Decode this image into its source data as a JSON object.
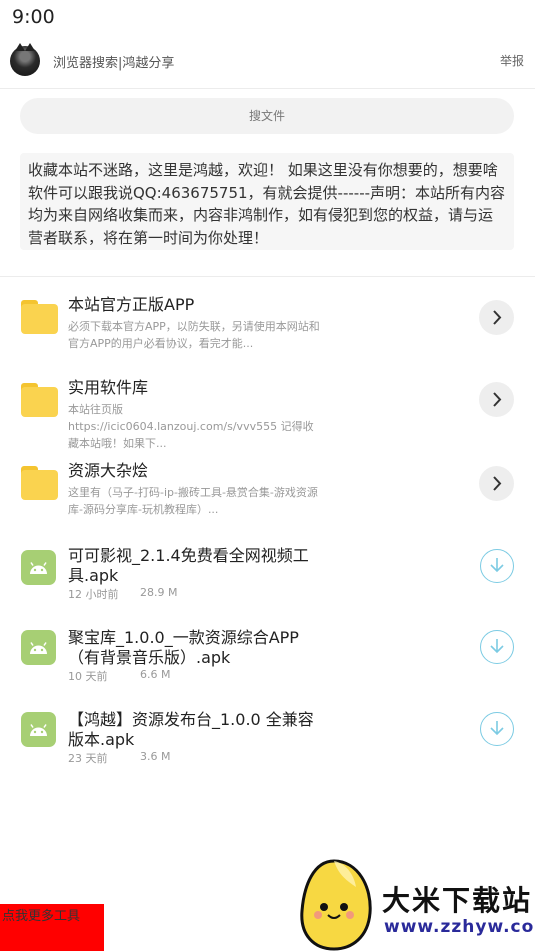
{
  "status_bar": {
    "time": "9:00"
  },
  "header": {
    "title": "浏览器搜索|鸿越分享",
    "report": "举报"
  },
  "search": {
    "placeholder": "搜文件"
  },
  "notice": {
    "text": "收藏本站不迷路，这里是鸿越，欢迎！ 如果这里没有你想要的，想要啥软件可以跟我说QQ:463675751，有就会提供------声明：本站所有内容均为来自网络收集而来，内容非鸿制作，如有侵犯到您的权益，请与运营者联系，将在第一时间为你处理！"
  },
  "folders": [
    {
      "title": "本站官方正版APP",
      "desc": "必须下载本官方APP，以防失联，另请使用本网站和官方APP的用户必看协议，看完才能...",
      "icon": "folder-icon"
    },
    {
      "title": "实用软件库",
      "desc": "本站往页版 https://icic0604.lanzouj.com/s/vvv555 记得收藏本站哦！如果下...",
      "icon": "folder-icon"
    },
    {
      "title": "资源大杂烩",
      "desc": "这里有（马子-打码-ip-搬砖工具-悬赏合集-游戏资源库-源码分享库-玩机教程库）...",
      "icon": "folder-icon"
    }
  ],
  "files": [
    {
      "title": "可可影视_2.1.4免费看全网视频工具.apk",
      "time": "12 小时前",
      "size": "28.9 M",
      "icon": "android-icon"
    },
    {
      "title": "聚宝库_1.0.0_一款资源综合APP（有背景音乐版）.apk",
      "time": "10 天前",
      "size": "6.6 M",
      "icon": "android-icon"
    },
    {
      "title": "【鸿越】资源发布台_1.0.0 全兼容版本.apk",
      "time": "23 天前",
      "size": "3.6 M",
      "icon": "android-icon"
    }
  ],
  "bottom_link": {
    "label": "点我更多工具"
  },
  "watermark": {
    "name": "大米下载站",
    "url": "www.zzhyw.com"
  },
  "colors": {
    "folder": "#fad34f",
    "android": "#a7cf74",
    "download_accent": "#7ccbe3",
    "bottom_link_bg": "#ff0000"
  }
}
